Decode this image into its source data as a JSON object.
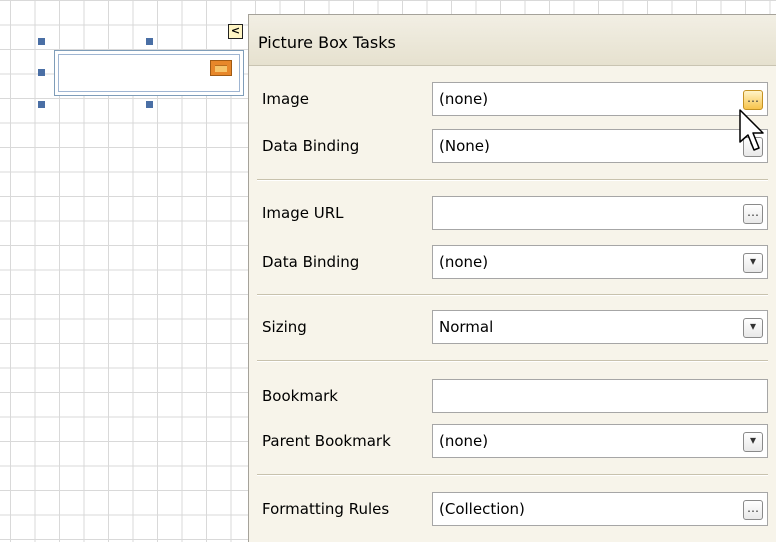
{
  "panel": {
    "title": "Picture Box Tasks",
    "rows": [
      {
        "label": "Image",
        "value": "(none)",
        "button": "…"
      },
      {
        "label": "Data Binding",
        "value": "(None)",
        "button": "▾"
      },
      {
        "label": "Image URL",
        "value": "",
        "button": "…"
      },
      {
        "label": "Data Binding",
        "value": "(none)",
        "button": "▾"
      },
      {
        "label": "Sizing",
        "value": "Normal",
        "button": "▾"
      },
      {
        "label": "Bookmark",
        "value": "",
        "button": ""
      },
      {
        "label": "Parent Bookmark",
        "value": "(none)",
        "button": "▾"
      },
      {
        "label": "Formatting Rules",
        "value": "(Collection)",
        "button": "…"
      }
    ]
  },
  "canvas": {
    "smart_tag_glyph": "<"
  },
  "icons": {
    "picture_box": "picture-icon",
    "cursor": "arrow-cursor-icon"
  },
  "colors": {
    "panel_bg": "#f7f4ea",
    "accent_button": "#f7c34a",
    "selection_handle": "#4a6fa5"
  }
}
